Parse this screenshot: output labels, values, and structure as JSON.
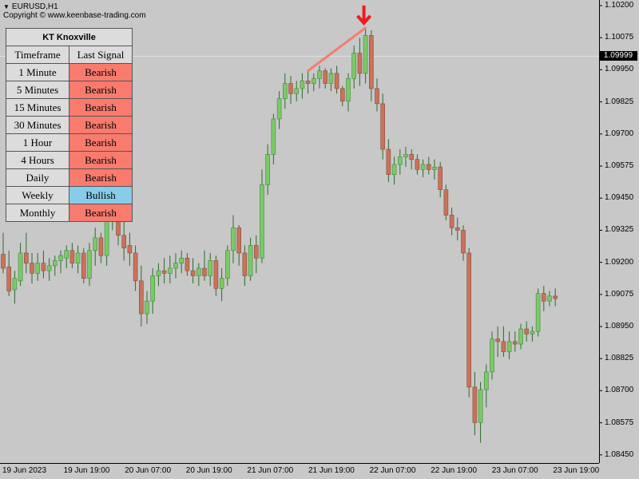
{
  "header": {
    "symbol": "EURUSD,H1",
    "copyright": "Copyright © www.keenbase-trading.com"
  },
  "price_axis": {
    "ticks": [
      "1.10200",
      "1.10075",
      "1.09950",
      "1.09825",
      "1.09700",
      "1.09575",
      "1.09450",
      "1.09325",
      "1.09200",
      "1.09075",
      "1.08950",
      "1.08825",
      "1.08700",
      "1.08575",
      "1.08450"
    ],
    "current_price": "1.09999"
  },
  "time_axis": {
    "labels": [
      "19 Jun 2023",
      "19 Jun 19:00",
      "20 Jun 07:00",
      "20 Jun 19:00",
      "21 Jun 07:00",
      "21 Jun 19:00",
      "22 Jun 07:00",
      "22 Jun 19:00",
      "23 Jun 07:00",
      "23 Jun 19:00"
    ]
  },
  "colors": {
    "background": "#c8c8c8",
    "bull_candle": "#7cc967",
    "bear_candle": "#c8735a",
    "wick": "#2e7d2e",
    "bearish_cell": "#f87b6e",
    "bullish_cell": "#87cdea",
    "signal_arrow": "#ee1c1c",
    "trend_line": "#f08070"
  },
  "panel": {
    "title": "KT Knoxville",
    "col_timeframe": "Timeframe",
    "col_signal": "Last Signal",
    "rows": [
      {
        "timeframe": "1 Minute",
        "signal": "Bearish"
      },
      {
        "timeframe": "5 Minutes",
        "signal": "Bearish"
      },
      {
        "timeframe": "15 Minutes",
        "signal": "Bearish"
      },
      {
        "timeframe": "30 Minutes",
        "signal": "Bearish"
      },
      {
        "timeframe": "1 Hour",
        "signal": "Bearish"
      },
      {
        "timeframe": "4 Hours",
        "signal": "Bearish"
      },
      {
        "timeframe": "Daily",
        "signal": "Bearish"
      },
      {
        "timeframe": "Weekly",
        "signal": "Bullish"
      },
      {
        "timeframe": "Monthly",
        "signal": "Bearish"
      }
    ]
  },
  "chart_data": {
    "type": "candlestick",
    "symbol": "EURUSD",
    "timeframe": "H1",
    "y_range": [
      1.084,
      1.1023
    ],
    "candles": [
      {
        "o": 1.09225,
        "h": 1.0931,
        "l": 1.0915,
        "c": 1.0917
      },
      {
        "o": 1.09175,
        "h": 1.0924,
        "l": 1.0906,
        "c": 1.0908
      },
      {
        "o": 1.09085,
        "h": 1.0916,
        "l": 1.0903,
        "c": 1.0913
      },
      {
        "o": 1.0912,
        "h": 1.0927,
        "l": 1.091,
        "c": 1.0923
      },
      {
        "o": 1.0923,
        "h": 1.0931,
        "l": 1.0915,
        "c": 1.0919
      },
      {
        "o": 1.0919,
        "h": 1.0923,
        "l": 1.0911,
        "c": 1.0915
      },
      {
        "o": 1.0915,
        "h": 1.0923,
        "l": 1.0912,
        "c": 1.0919
      },
      {
        "o": 1.0919,
        "h": 1.0924,
        "l": 1.0913,
        "c": 1.0916
      },
      {
        "o": 1.0916,
        "h": 1.0921,
        "l": 1.0912,
        "c": 1.0918
      },
      {
        "o": 1.0918,
        "h": 1.0922,
        "l": 1.0914,
        "c": 1.092
      },
      {
        "o": 1.092,
        "h": 1.0924,
        "l": 1.0915,
        "c": 1.0922
      },
      {
        "o": 1.0921,
        "h": 1.0926,
        "l": 1.0917,
        "c": 1.0924
      },
      {
        "o": 1.0924,
        "h": 1.0927,
        "l": 1.0917,
        "c": 1.0919
      },
      {
        "o": 1.0919,
        "h": 1.0926,
        "l": 1.0915,
        "c": 1.0923
      },
      {
        "o": 1.0923,
        "h": 1.0925,
        "l": 1.0911,
        "c": 1.0913
      },
      {
        "o": 1.0913,
        "h": 1.0927,
        "l": 1.091,
        "c": 1.0924
      },
      {
        "o": 1.0924,
        "h": 1.0933,
        "l": 1.0918,
        "c": 1.0929
      },
      {
        "o": 1.0929,
        "h": 1.0931,
        "l": 1.0919,
        "c": 1.0922
      },
      {
        "o": 1.0922,
        "h": 1.0948,
        "l": 1.0918,
        "c": 1.0944
      },
      {
        "o": 1.0944,
        "h": 1.0947,
        "l": 1.0932,
        "c": 1.0936
      },
      {
        "o": 1.0936,
        "h": 1.0942,
        "l": 1.0926,
        "c": 1.093
      },
      {
        "o": 1.093,
        "h": 1.0936,
        "l": 1.092,
        "c": 1.0925
      },
      {
        "o": 1.0926,
        "h": 1.0931,
        "l": 1.0918,
        "c": 1.0923
      },
      {
        "o": 1.0923,
        "h": 1.0926,
        "l": 1.0908,
        "c": 1.0912
      },
      {
        "o": 1.0912,
        "h": 1.0918,
        "l": 1.0894,
        "c": 1.0899
      },
      {
        "o": 1.0899,
        "h": 1.0908,
        "l": 1.0895,
        "c": 1.0904
      },
      {
        "o": 1.0904,
        "h": 1.0917,
        "l": 1.0899,
        "c": 1.0914
      },
      {
        "o": 1.0914,
        "h": 1.0919,
        "l": 1.091,
        "c": 1.0916
      },
      {
        "o": 1.0916,
        "h": 1.0921,
        "l": 1.0911,
        "c": 1.0915
      },
      {
        "o": 1.0915,
        "h": 1.0922,
        "l": 1.0911,
        "c": 1.0917
      },
      {
        "o": 1.0917,
        "h": 1.0923,
        "l": 1.0913,
        "c": 1.0919
      },
      {
        "o": 1.0919,
        "h": 1.0924,
        "l": 1.0915,
        "c": 1.0921
      },
      {
        "o": 1.0921,
        "h": 1.0923,
        "l": 1.0914,
        "c": 1.0916
      },
      {
        "o": 1.0916,
        "h": 1.0921,
        "l": 1.0911,
        "c": 1.0914
      },
      {
        "o": 1.0914,
        "h": 1.0919,
        "l": 1.091,
        "c": 1.0917
      },
      {
        "o": 1.0917,
        "h": 1.0924,
        "l": 1.0912,
        "c": 1.0914
      },
      {
        "o": 1.0914,
        "h": 1.0923,
        "l": 1.091,
        "c": 1.092
      },
      {
        "o": 1.092,
        "h": 1.0922,
        "l": 1.0906,
        "c": 1.0909
      },
      {
        "o": 1.0909,
        "h": 1.0917,
        "l": 1.0904,
        "c": 1.0913
      },
      {
        "o": 1.0913,
        "h": 1.0926,
        "l": 1.091,
        "c": 1.0924
      },
      {
        "o": 1.0924,
        "h": 1.0938,
        "l": 1.0919,
        "c": 1.0933
      },
      {
        "o": 1.0933,
        "h": 1.0934,
        "l": 1.0918,
        "c": 1.0923
      },
      {
        "o": 1.0923,
        "h": 1.0926,
        "l": 1.091,
        "c": 1.0914
      },
      {
        "o": 1.0914,
        "h": 1.0929,
        "l": 1.0912,
        "c": 1.0926
      },
      {
        "o": 1.0926,
        "h": 1.093,
        "l": 1.0915,
        "c": 1.0921
      },
      {
        "o": 1.0921,
        "h": 1.0956,
        "l": 1.0919,
        "c": 1.095
      },
      {
        "o": 1.095,
        "h": 1.0966,
        "l": 1.0946,
        "c": 1.0962
      },
      {
        "o": 1.0962,
        "h": 1.0978,
        "l": 1.0958,
        "c": 1.0976
      },
      {
        "o": 1.0976,
        "h": 1.0987,
        "l": 1.0972,
        "c": 1.0984
      },
      {
        "o": 1.0984,
        "h": 1.0994,
        "l": 1.098,
        "c": 1.099
      },
      {
        "o": 1.099,
        "h": 1.0993,
        "l": 1.0982,
        "c": 1.0986
      },
      {
        "o": 1.0986,
        "h": 1.0991,
        "l": 1.0983,
        "c": 1.0988
      },
      {
        "o": 1.0988,
        "h": 1.0994,
        "l": 1.0984,
        "c": 1.0991
      },
      {
        "o": 1.0991,
        "h": 1.0995,
        "l": 1.0986,
        "c": 1.099
      },
      {
        "o": 1.099,
        "h": 1.0994,
        "l": 1.0987,
        "c": 1.0992
      },
      {
        "o": 1.0992,
        "h": 1.0997,
        "l": 1.0988,
        "c": 1.0995
      },
      {
        "o": 1.0995,
        "h": 1.0996,
        "l": 1.0988,
        "c": 1.099
      },
      {
        "o": 1.099,
        "h": 1.0996,
        "l": 1.0987,
        "c": 1.0994
      },
      {
        "o": 1.0994,
        "h": 1.0997,
        "l": 1.0986,
        "c": 1.0988
      },
      {
        "o": 1.0988,
        "h": 1.0989,
        "l": 1.0981,
        "c": 1.0983
      },
      {
        "o": 1.0983,
        "h": 1.0994,
        "l": 1.0979,
        "c": 1.0992
      },
      {
        "o": 1.0992,
        "h": 1.1005,
        "l": 1.0988,
        "c": 1.1002
      },
      {
        "o": 1.1002,
        "h": 1.1008,
        "l": 1.0989,
        "c": 1.0994
      },
      {
        "o": 1.0994,
        "h": 1.1012,
        "l": 1.099,
        "c": 1.1009
      },
      {
        "o": 1.1009,
        "h": 1.1011,
        "l": 1.0983,
        "c": 1.0988
      },
      {
        "o": 1.0988,
        "h": 1.0992,
        "l": 1.0979,
        "c": 1.0982
      },
      {
        "o": 1.0982,
        "h": 1.0986,
        "l": 1.096,
        "c": 1.0964
      },
      {
        "o": 1.0964,
        "h": 1.0968,
        "l": 1.0951,
        "c": 1.0954
      },
      {
        "o": 1.0954,
        "h": 1.0961,
        "l": 1.095,
        "c": 1.0958
      },
      {
        "o": 1.0958,
        "h": 1.0964,
        "l": 1.0954,
        "c": 1.0961
      },
      {
        "o": 1.0961,
        "h": 1.0965,
        "l": 1.0957,
        "c": 1.0962
      },
      {
        "o": 1.0962,
        "h": 1.0964,
        "l": 1.0956,
        "c": 1.096
      },
      {
        "o": 1.096,
        "h": 1.0962,
        "l": 1.0954,
        "c": 1.0956
      },
      {
        "o": 1.0956,
        "h": 1.096,
        "l": 1.0953,
        "c": 1.0958
      },
      {
        "o": 1.0958,
        "h": 1.0961,
        "l": 1.0954,
        "c": 1.0956
      },
      {
        "o": 1.0956,
        "h": 1.096,
        "l": 1.0952,
        "c": 1.0957
      },
      {
        "o": 1.0957,
        "h": 1.0959,
        "l": 1.0945,
        "c": 1.0948
      },
      {
        "o": 1.0948,
        "h": 1.095,
        "l": 1.0936,
        "c": 1.0938
      },
      {
        "o": 1.0938,
        "h": 1.0941,
        "l": 1.093,
        "c": 1.0933
      },
      {
        "o": 1.0933,
        "h": 1.0937,
        "l": 1.0928,
        "c": 1.0932
      },
      {
        "o": 1.0932,
        "h": 1.0934,
        "l": 1.092,
        "c": 1.0923
      },
      {
        "o": 1.0923,
        "h": 1.0925,
        "l": 1.0866,
        "c": 1.087
      },
      {
        "o": 1.087,
        "h": 1.0876,
        "l": 1.0851,
        "c": 1.0856
      },
      {
        "o": 1.0856,
        "h": 1.0872,
        "l": 1.0848,
        "c": 1.0869
      },
      {
        "o": 1.0869,
        "h": 1.0879,
        "l": 1.0862,
        "c": 1.0876
      },
      {
        "o": 1.0876,
        "h": 1.0892,
        "l": 1.0873,
        "c": 1.0889
      },
      {
        "o": 1.0889,
        "h": 1.0894,
        "l": 1.0882,
        "c": 1.0888
      },
      {
        "o": 1.0888,
        "h": 1.0894,
        "l": 1.0882,
        "c": 1.0884
      },
      {
        "o": 1.0884,
        "h": 1.0892,
        "l": 1.0881,
        "c": 1.0888
      },
      {
        "o": 1.0888,
        "h": 1.0892,
        "l": 1.0884,
        "c": 1.0887
      },
      {
        "o": 1.0887,
        "h": 1.0895,
        "l": 1.0885,
        "c": 1.0893
      },
      {
        "o": 1.0893,
        "h": 1.0896,
        "l": 1.0888,
        "c": 1.0891
      },
      {
        "o": 1.0891,
        "h": 1.0894,
        "l": 1.0888,
        "c": 1.0892
      },
      {
        "o": 1.0892,
        "h": 1.0909,
        "l": 1.089,
        "c": 1.0907
      },
      {
        "o": 1.0907,
        "h": 1.091,
        "l": 1.09,
        "c": 1.0904
      },
      {
        "o": 1.0904,
        "h": 1.0908,
        "l": 1.0902,
        "c": 1.0906
      },
      {
        "o": 1.0906,
        "h": 1.0909,
        "l": 1.0902,
        "c": 1.0905
      }
    ],
    "trend_line": {
      "from_candle": 53,
      "to_candle": 63,
      "from_price": 1.0995,
      "to_price": 1.1012
    },
    "sell_signal_candle": 63
  }
}
